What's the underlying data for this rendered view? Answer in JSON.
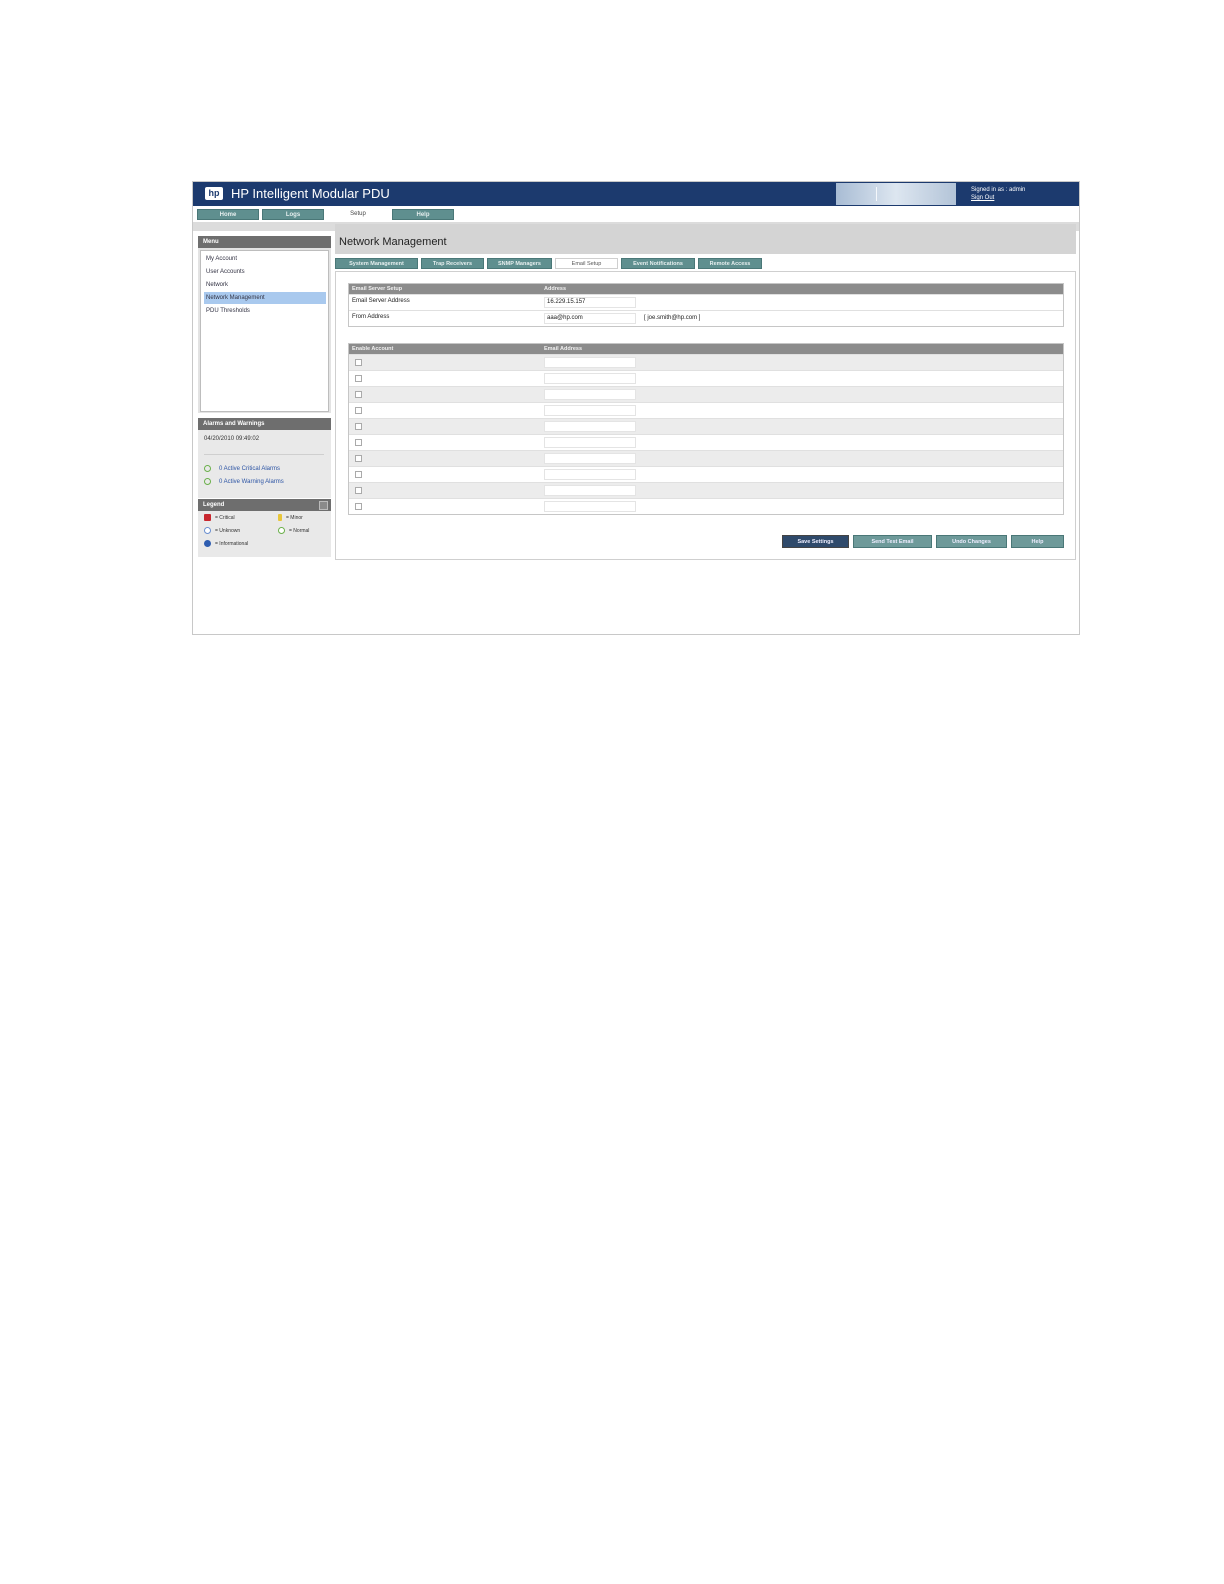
{
  "header": {
    "logo": "hp",
    "title": "HP Intelligent Modular PDU",
    "signed_in": "Signed in as : admin",
    "sign_out": "Sign Out"
  },
  "main_tabs": [
    "Home",
    "Logs",
    "Setup",
    "Help"
  ],
  "menu": {
    "title": "Menu",
    "items": [
      "My Account",
      "User Accounts",
      "Network",
      "Network Management",
      "PDU Thresholds"
    ],
    "selected": "Network Management"
  },
  "alarms": {
    "title": "Alarms and Warnings",
    "timestamp": "04/20/2010 09:49:02",
    "critical": "0 Active Critical Alarms",
    "warning": "0 Active Warning Alarms"
  },
  "legend": {
    "title": "Legend",
    "critical": "= Critical",
    "minor": "= Minor",
    "unknown": "= Unknown",
    "normal": "= Normal",
    "informational": "= Informational"
  },
  "page": {
    "title": "Network Management"
  },
  "sub_tabs": [
    "System Management",
    "Trap Receivers",
    "SNMP Managers",
    "Email Setup",
    "Event Notifications",
    "Remote Access"
  ],
  "active_sub_tab": "Email Setup",
  "email_server": {
    "col1": "Email Server Setup",
    "col2": "Address",
    "rows": [
      {
        "label": "Email Server Address",
        "value": "16.229.15.157",
        "hint": ""
      },
      {
        "label": "From Address",
        "value": "aaa@hp.com",
        "hint": "[ joe.smith@hp.com ]"
      }
    ]
  },
  "accounts": {
    "col1": "Enable Account",
    "col2": "Email Address",
    "row_count": 10
  },
  "buttons": {
    "save": "Save Settings",
    "send_test": "Send Test Email",
    "undo": "Undo Changes",
    "help": "Help"
  },
  "colors": {
    "header_blue": "#1c3a6e",
    "tab_teal": "#5f8f8f",
    "selected_menu": "#a9c9ee",
    "primary_button": "#2f4a6b"
  }
}
